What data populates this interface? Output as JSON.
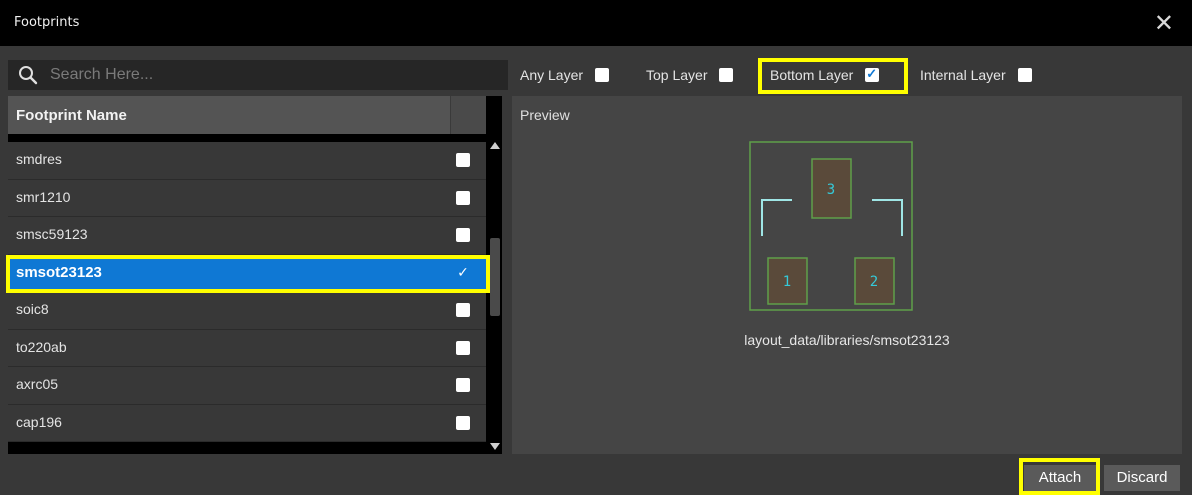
{
  "window": {
    "title": "Footprints",
    "close_glyph": "✕"
  },
  "search": {
    "placeholder": "Search Here...",
    "icon": "search-icon"
  },
  "table": {
    "header": "Footprint Name",
    "rows": [
      {
        "name": "smdres",
        "checked": false
      },
      {
        "name": "smr1210",
        "checked": false
      },
      {
        "name": "smsc59123",
        "checked": false
      },
      {
        "name": "smsot23123",
        "checked": true,
        "selected": true
      },
      {
        "name": "soic8",
        "checked": false
      },
      {
        "name": "to220ab",
        "checked": false
      },
      {
        "name": "axrc05",
        "checked": false
      },
      {
        "name": "cap196",
        "checked": false
      }
    ]
  },
  "layers": {
    "any": {
      "label": "Any Layer",
      "checked": false
    },
    "top": {
      "label": "Top Layer",
      "checked": false
    },
    "bottom": {
      "label": "Bottom Layer",
      "checked": true
    },
    "internal": {
      "label": "Internal Layer",
      "checked": false
    }
  },
  "preview": {
    "label": "Preview",
    "pads": [
      "1",
      "2",
      "3"
    ],
    "path": "layout_data/libraries/smsot23123"
  },
  "buttons": {
    "attach": "Attach",
    "discard": "Discard"
  },
  "colors": {
    "selection": "#0f78d4",
    "highlight": "#ffff00",
    "pad_outline": "#5fa04a",
    "pad_text": "#35c9d8",
    "silkscreen": "#9fe6e6"
  }
}
